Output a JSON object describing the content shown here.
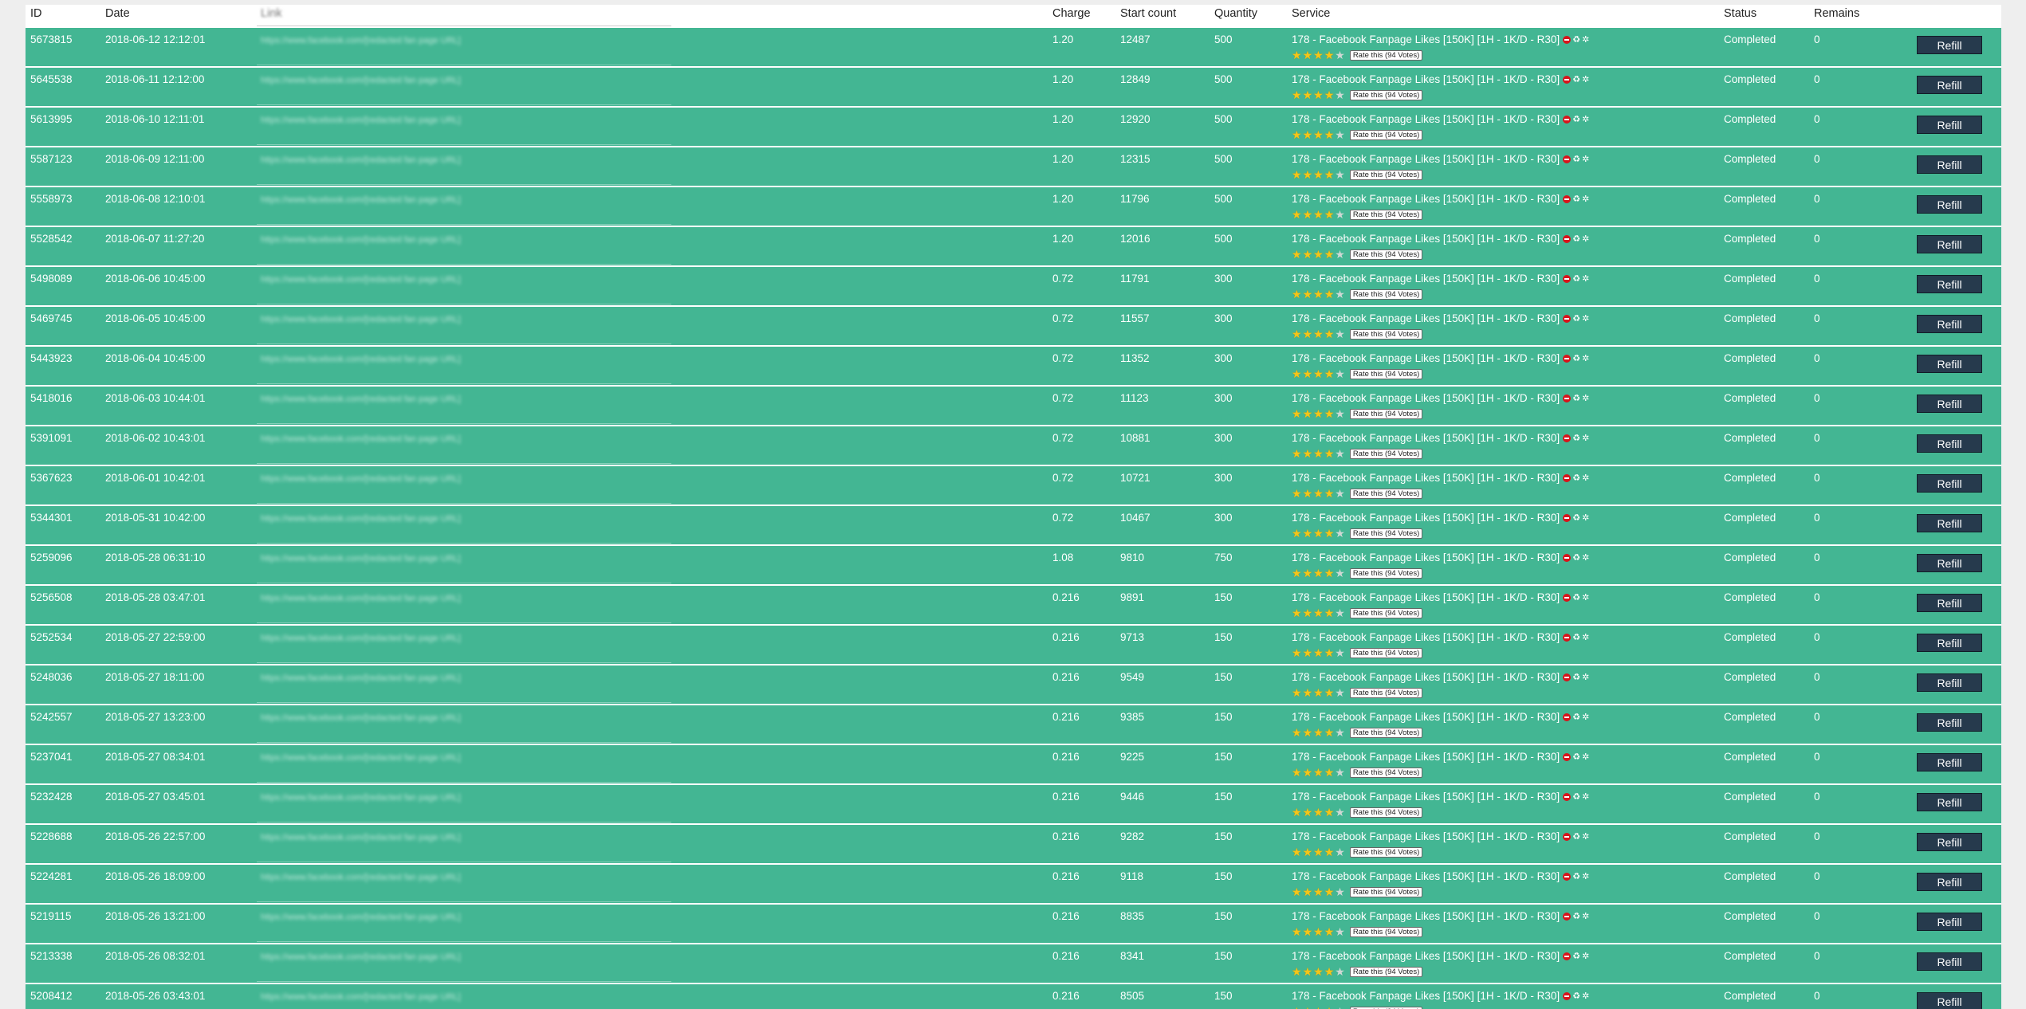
{
  "columns": {
    "id": "ID",
    "date": "Date",
    "link": "Link",
    "charge": "Charge",
    "start_count": "Start count",
    "quantity": "Quantity",
    "service": "Service",
    "status": "Status",
    "remains": "Remains"
  },
  "service_name": "178 - Facebook Fanpage Likes [150K] [1H - 1K/D - R30]",
  "rate_label": "Rate this (94 Votes)",
  "rating_stars": 4,
  "rating_max": 5,
  "refill_label": "Refill",
  "link_text": "https://www.facebook.com/[redacted fan page URL]",
  "colors": {
    "row_bg": "#43b693",
    "refill_btn": "#263a4d",
    "star": "#f5c518"
  },
  "orders": [
    {
      "id": "5673815",
      "date": "2018-06-12 12:12:01",
      "charge": "1.20",
      "start_count": "12487",
      "quantity": "500",
      "status": "Completed",
      "remains": "0"
    },
    {
      "id": "5645538",
      "date": "2018-06-11 12:12:00",
      "charge": "1.20",
      "start_count": "12849",
      "quantity": "500",
      "status": "Completed",
      "remains": "0"
    },
    {
      "id": "5613995",
      "date": "2018-06-10 12:11:01",
      "charge": "1.20",
      "start_count": "12920",
      "quantity": "500",
      "status": "Completed",
      "remains": "0"
    },
    {
      "id": "5587123",
      "date": "2018-06-09 12:11:00",
      "charge": "1.20",
      "start_count": "12315",
      "quantity": "500",
      "status": "Completed",
      "remains": "0"
    },
    {
      "id": "5558973",
      "date": "2018-06-08 12:10:01",
      "charge": "1.20",
      "start_count": "11796",
      "quantity": "500",
      "status": "Completed",
      "remains": "0"
    },
    {
      "id": "5528542",
      "date": "2018-06-07 11:27:20",
      "charge": "1.20",
      "start_count": "12016",
      "quantity": "500",
      "status": "Completed",
      "remains": "0"
    },
    {
      "id": "5498089",
      "date": "2018-06-06 10:45:00",
      "charge": "0.72",
      "start_count": "11791",
      "quantity": "300",
      "status": "Completed",
      "remains": "0"
    },
    {
      "id": "5469745",
      "date": "2018-06-05 10:45:00",
      "charge": "0.72",
      "start_count": "11557",
      "quantity": "300",
      "status": "Completed",
      "remains": "0"
    },
    {
      "id": "5443923",
      "date": "2018-06-04 10:45:00",
      "charge": "0.72",
      "start_count": "11352",
      "quantity": "300",
      "status": "Completed",
      "remains": "0"
    },
    {
      "id": "5418016",
      "date": "2018-06-03 10:44:01",
      "charge": "0.72",
      "start_count": "11123",
      "quantity": "300",
      "status": "Completed",
      "remains": "0"
    },
    {
      "id": "5391091",
      "date": "2018-06-02 10:43:01",
      "charge": "0.72",
      "start_count": "10881",
      "quantity": "300",
      "status": "Completed",
      "remains": "0"
    },
    {
      "id": "5367623",
      "date": "2018-06-01 10:42:01",
      "charge": "0.72",
      "start_count": "10721",
      "quantity": "300",
      "status": "Completed",
      "remains": "0"
    },
    {
      "id": "5344301",
      "date": "2018-05-31 10:42:00",
      "charge": "0.72",
      "start_count": "10467",
      "quantity": "300",
      "status": "Completed",
      "remains": "0"
    },
    {
      "id": "5259096",
      "date": "2018-05-28 06:31:10",
      "charge": "1.08",
      "start_count": "9810",
      "quantity": "750",
      "status": "Completed",
      "remains": "0"
    },
    {
      "id": "5256508",
      "date": "2018-05-28 03:47:01",
      "charge": "0.216",
      "start_count": "9891",
      "quantity": "150",
      "status": "Completed",
      "remains": "0"
    },
    {
      "id": "5252534",
      "date": "2018-05-27 22:59:00",
      "charge": "0.216",
      "start_count": "9713",
      "quantity": "150",
      "status": "Completed",
      "remains": "0"
    },
    {
      "id": "5248036",
      "date": "2018-05-27 18:11:00",
      "charge": "0.216",
      "start_count": "9549",
      "quantity": "150",
      "status": "Completed",
      "remains": "0"
    },
    {
      "id": "5242557",
      "date": "2018-05-27 13:23:00",
      "charge": "0.216",
      "start_count": "9385",
      "quantity": "150",
      "status": "Completed",
      "remains": "0"
    },
    {
      "id": "5237041",
      "date": "2018-05-27 08:34:01",
      "charge": "0.216",
      "start_count": "9225",
      "quantity": "150",
      "status": "Completed",
      "remains": "0"
    },
    {
      "id": "5232428",
      "date": "2018-05-27 03:45:01",
      "charge": "0.216",
      "start_count": "9446",
      "quantity": "150",
      "status": "Completed",
      "remains": "0"
    },
    {
      "id": "5228688",
      "date": "2018-05-26 22:57:00",
      "charge": "0.216",
      "start_count": "9282",
      "quantity": "150",
      "status": "Completed",
      "remains": "0"
    },
    {
      "id": "5224281",
      "date": "2018-05-26 18:09:00",
      "charge": "0.216",
      "start_count": "9118",
      "quantity": "150",
      "status": "Completed",
      "remains": "0"
    },
    {
      "id": "5219115",
      "date": "2018-05-26 13:21:00",
      "charge": "0.216",
      "start_count": "8835",
      "quantity": "150",
      "status": "Completed",
      "remains": "0"
    },
    {
      "id": "5213338",
      "date": "2018-05-26 08:32:01",
      "charge": "0.216",
      "start_count": "8341",
      "quantity": "150",
      "status": "Completed",
      "remains": "0"
    },
    {
      "id": "5208412",
      "date": "2018-05-26 03:43:01",
      "charge": "0.216",
      "start_count": "8505",
      "quantity": "150",
      "status": "Completed",
      "remains": "0"
    }
  ]
}
